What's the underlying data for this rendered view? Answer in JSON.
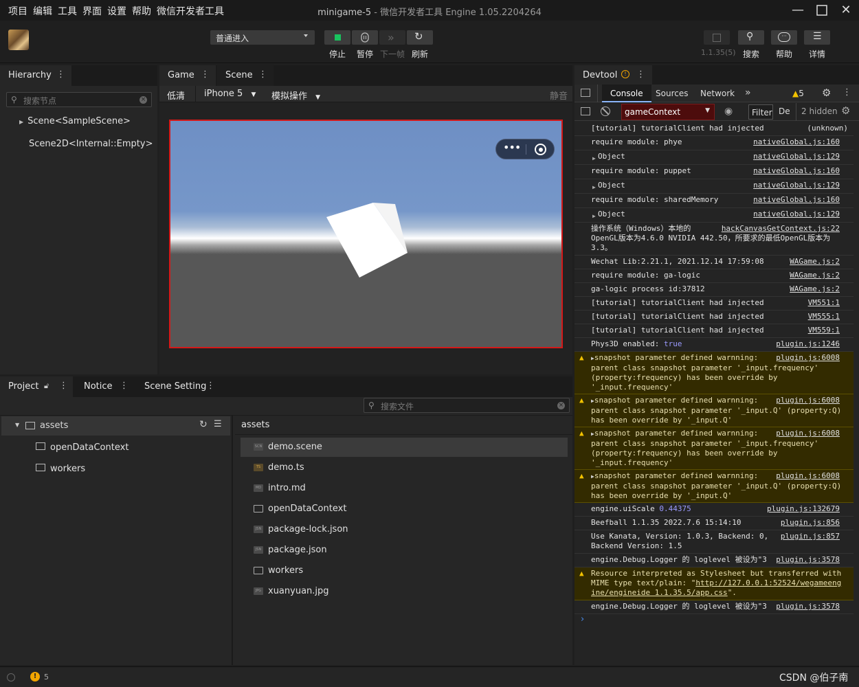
{
  "menu": [
    "项目",
    "编辑",
    "工具",
    "界面",
    "设置",
    "帮助",
    "微信开发者工具"
  ],
  "window": {
    "title_main": "minigame-5",
    "title_sub": " - 微信开发者工具 Engine 1.05.2204264"
  },
  "toolbar": {
    "mode_select": "普通进入",
    "stop_label": "停止",
    "pause_label": "暂停",
    "next_frame_label": "下一帧",
    "refresh_label": "刷新",
    "version": "1.1.35(5)",
    "search_label": "搜索",
    "help_label": "帮助",
    "details_label": "详情"
  },
  "hierarchy": {
    "tab": "Hierarchy",
    "search_placeholder": "搜索节点",
    "items": [
      "Scene<SampleScene>",
      "Scene2D<Internal::Empty>"
    ]
  },
  "game": {
    "tabs": [
      "Game",
      "Scene"
    ],
    "quality": "低清",
    "device": "iPhone 5",
    "simulate": "模拟操作",
    "mute": "静音"
  },
  "project": {
    "tabs": [
      "Project",
      "Notice",
      "Scene Setting"
    ],
    "search_placeholder": "搜索文件",
    "tree": {
      "root": "assets",
      "children": [
        "openDataContext",
        "workers"
      ]
    },
    "path": "assets",
    "files": [
      {
        "name": "demo.scene",
        "type": "SCN"
      },
      {
        "name": "demo.ts",
        "type": "TS"
      },
      {
        "name": "intro.md",
        "type": "MD"
      },
      {
        "name": "openDataContext",
        "type": "folder"
      },
      {
        "name": "package-lock.json",
        "type": "JSN"
      },
      {
        "name": "package.json",
        "type": "JSN"
      },
      {
        "name": "workers",
        "type": "folder"
      },
      {
        "name": "xuanyuan.jpg",
        "type": "JPG"
      }
    ]
  },
  "devtool": {
    "tab": "Devtool",
    "tabs": [
      "Console",
      "Sources",
      "Network"
    ],
    "more": "»",
    "warn_count": "5",
    "context": "gameContext",
    "filter": "Filter",
    "levels": "De",
    "hidden": "2 hidden",
    "logs": [
      {
        "text": "[tutorial] tutorialClient had injected",
        "src": "(unknown)",
        "plain": true
      },
      {
        "text": "require module: phye",
        "src": "nativeGlobal.js:160"
      },
      {
        "text": "Object",
        "src": "nativeGlobal.js:129",
        "obj": true
      },
      {
        "text": "require module: puppet",
        "src": "nativeGlobal.js:160"
      },
      {
        "text": "Object",
        "src": "nativeGlobal.js:129",
        "obj": true
      },
      {
        "text": "require module: sharedMemory",
        "src": "nativeGlobal.js:160"
      },
      {
        "text": "Object",
        "src": "nativeGlobal.js:129",
        "obj": true
      },
      {
        "text": "操作系统（Windows）本地的",
        "text2": "OpenGL版本为4.6.0 NVIDIA 442.50，所要求的最低OpenGL版本为",
        "text3": "3.3。",
        "src": "hackCanvasGetContext.js:22"
      },
      {
        "text": "Wechat Lib:2.21.1, 2021.12.14 17:59:08",
        "src": "WAGame.js:2"
      },
      {
        "text": "require module: ga-logic",
        "src": "WAGame.js:2"
      },
      {
        "text": "ga-logic process id:37812",
        "src": "WAGame.js:2"
      },
      {
        "text": "[tutorial] tutorialClient had injected",
        "src": "VM551:1"
      },
      {
        "text": "[tutorial] tutorialClient had injected",
        "src": "VM555:1"
      },
      {
        "text": "[tutorial] tutorialClient had injected",
        "src": "VM559:1"
      },
      {
        "text": "Phys3D enabled:",
        "value": "true",
        "src": "plugin.js:1246"
      },
      {
        "warn": true,
        "text": "snapshot parameter defined warnning:",
        "text2": "parent class snapshot parameter '_input.frequency'",
        "text3": "(property:frequency) has been override by",
        "text4": "'_input.frequency'",
        "src": "plugin.js:6008"
      },
      {
        "warn": true,
        "text": "snapshot parameter defined warnning:",
        "text2": "parent class snapshot parameter '_input.Q' (property:Q)",
        "text3": "has been override by '_input.Q'",
        "src": "plugin.js:6008"
      },
      {
        "warn": true,
        "text": "snapshot parameter defined warnning:",
        "text2": "parent class snapshot parameter '_input.frequency'",
        "text3": "(property:frequency) has been override by",
        "text4": "'_input.frequency'",
        "src": "plugin.js:6008"
      },
      {
        "warn": true,
        "text": "snapshot parameter defined warnning:",
        "text2": "parent class snapshot parameter '_input.Q' (property:Q)",
        "text3": "has been override by '_input.Q'",
        "src": "plugin.js:6008"
      },
      {
        "text": "engine.uiScale",
        "value": "0.44375",
        "src": "plugin.js:132679"
      },
      {
        "text": "Beefball 1.1.35 2022.7.6 15:14:10",
        "src": "plugin.js:856"
      },
      {
        "text": "Use Kanata, Version: 1.0.3, Backend: 0,",
        "text2": "Backend Version: 1.5",
        "src": "plugin.js:857"
      },
      {
        "text": "engine.Debug.Logger 的 loglevel 被设为\"3",
        "src": "plugin.js:3578"
      },
      {
        "warn": true,
        "text": "Resource interpreted as Stylesheet but transferred with",
        "text2": "MIME type text/plain: \"",
        "link1": "http://127.0.0.1:52524/wegameeng",
        "link2": "ine/engineide 1.1.35.5/app.css",
        "tail": "\"."
      },
      {
        "text": "engine.Debug.Logger 的 loglevel 被设为\"3",
        "src": "plugin.js:3578"
      }
    ],
    "prompt": "›"
  },
  "status": {
    "warn_count": "5",
    "watermark": "CSDN @伯子南"
  },
  "colors": {
    "accent_red": "#d51818",
    "sky": "#6e8fc4",
    "ground": "#575757",
    "warning": "#f2c200"
  }
}
